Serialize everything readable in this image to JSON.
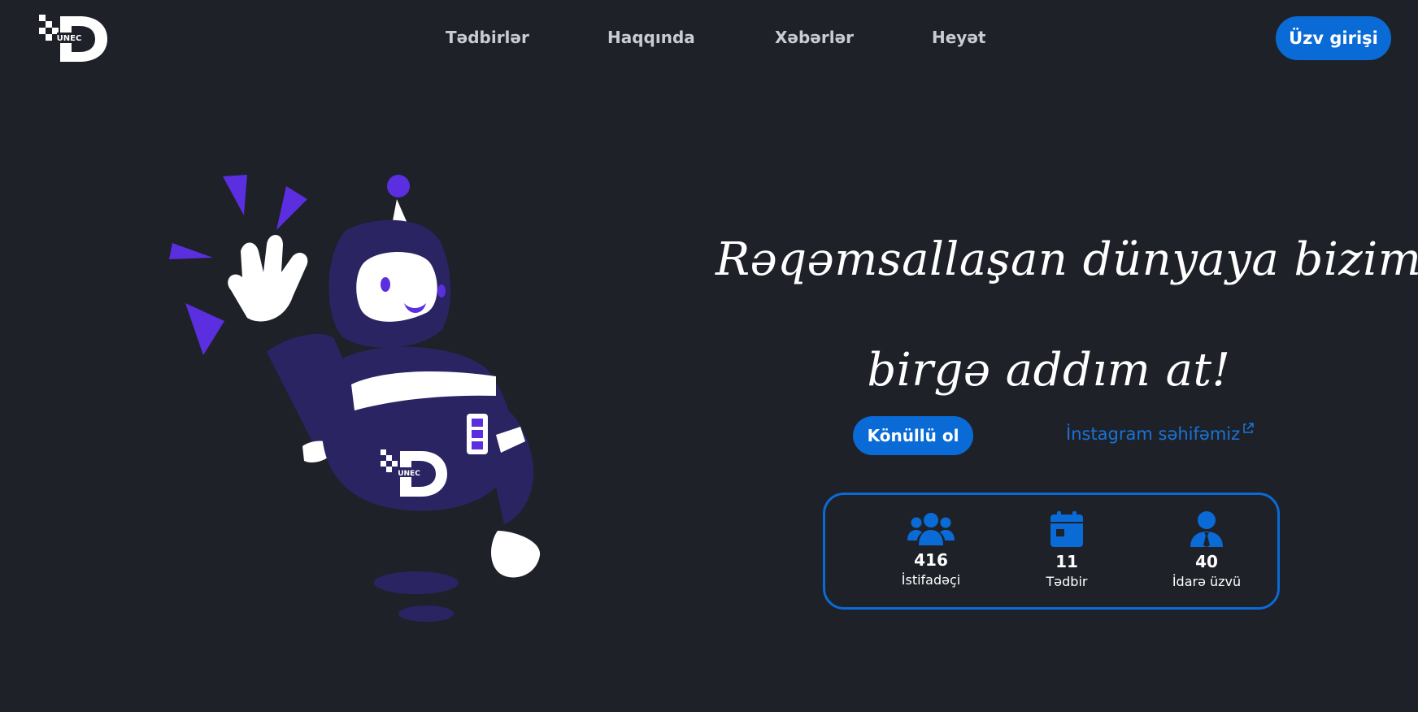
{
  "header": {
    "logo_text": "UNEC",
    "nav": [
      {
        "label": "Tədbirlər"
      },
      {
        "label": "Haqqında"
      },
      {
        "label": "Xəbərlər"
      },
      {
        "label": "Heyət"
      }
    ],
    "login_label": "Üzv girişi"
  },
  "illustration": {
    "badge_text": "UNEC"
  },
  "hero": {
    "title_line1": "Rəqəmsallaşan dünyaya bizimlə",
    "title_line2": "birgə addım at!",
    "volunteer_label": "Könüllü ol",
    "instagram_label": "İnstagram səhifəmiz"
  },
  "stats": [
    {
      "icon": "users-icon",
      "value": "416",
      "label": "İstifadəçi"
    },
    {
      "icon": "calendar-icon",
      "value": "11",
      "label": "Tədbir"
    },
    {
      "icon": "user-tie-icon",
      "value": "40",
      "label": "İdarə üzvü"
    }
  ],
  "colors": {
    "background": "#1e2128",
    "accent": "#0a6bd6",
    "robot_body": "#2a2463",
    "robot_accent": "#5b2ee0",
    "nav_text": "#c9ccd2"
  }
}
